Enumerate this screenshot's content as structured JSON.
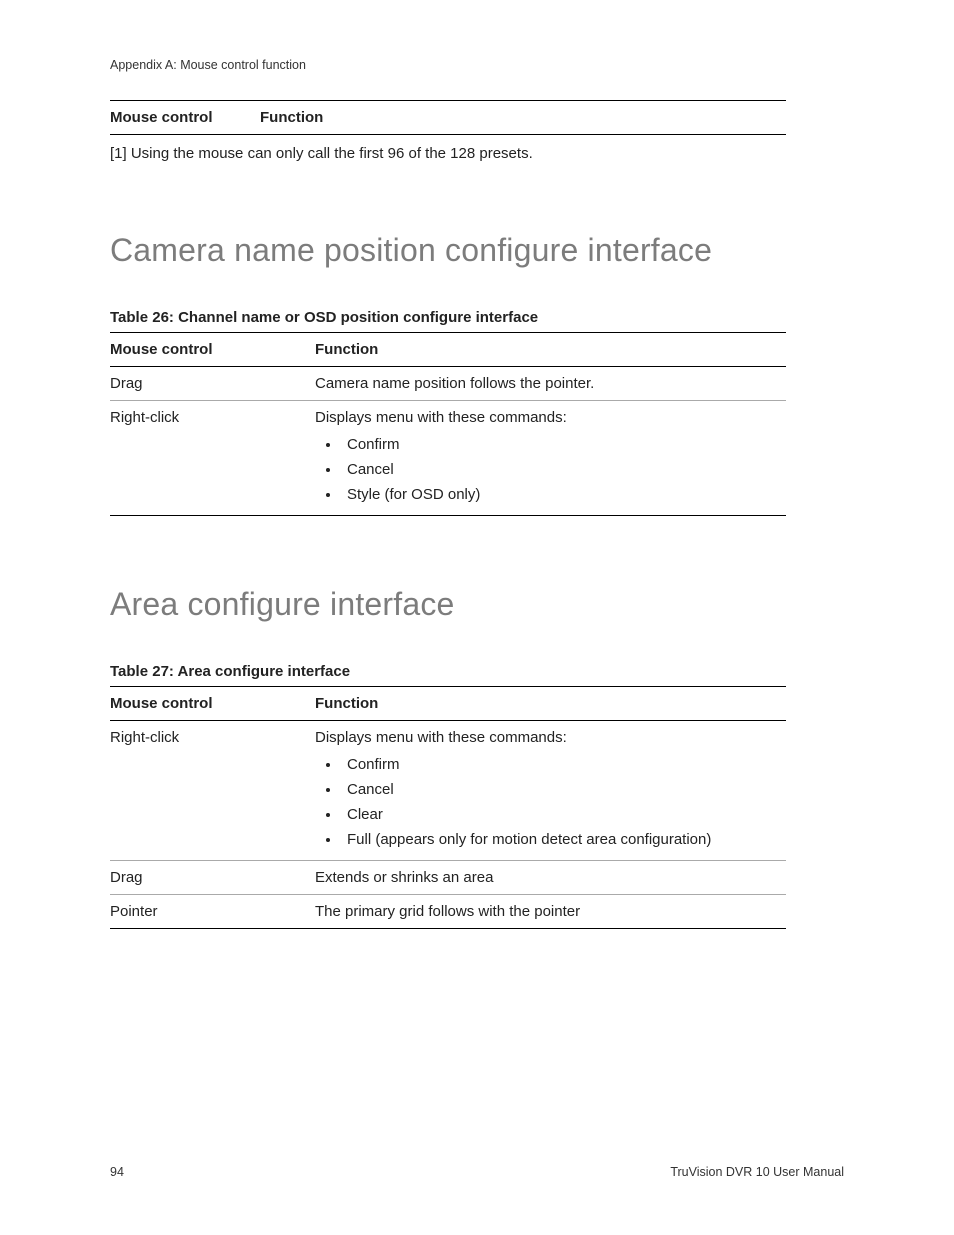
{
  "appendix_label": "Appendix A: Mouse control function",
  "top_table": {
    "col1": "Mouse control",
    "col2": "Function"
  },
  "footnote": "[1] Using the mouse can only call the first 96 of the 128 presets.",
  "section1": {
    "title": "Camera name position configure interface",
    "table_caption": "Table 26: Channel name or OSD position configure interface",
    "headers": {
      "col1": "Mouse control",
      "col2": "Function"
    },
    "rows": [
      {
        "mc": "Drag",
        "fn_text": "Camera name position follows the pointer.",
        "items": []
      },
      {
        "mc": "Right-click",
        "fn_text": "Displays menu with these commands:",
        "items": [
          "Confirm",
          "Cancel",
          "Style (for OSD only)"
        ]
      }
    ]
  },
  "section2": {
    "title": "Area configure interface",
    "table_caption": "Table 27: Area configure interface",
    "headers": {
      "col1": "Mouse control",
      "col2": "Function"
    },
    "rows": [
      {
        "mc": "Right-click",
        "fn_text": "Displays menu with these commands:",
        "items": [
          "Confirm",
          "Cancel",
          "Clear",
          "Full (appears only for motion detect area configuration)"
        ]
      },
      {
        "mc": "Drag",
        "fn_text": "Extends or shrinks an area",
        "items": []
      },
      {
        "mc": "Pointer",
        "fn_text": "The primary grid follows with the pointer",
        "items": []
      }
    ]
  },
  "footer": {
    "page": "94",
    "manual": "TruVision DVR 10 User Manual"
  }
}
